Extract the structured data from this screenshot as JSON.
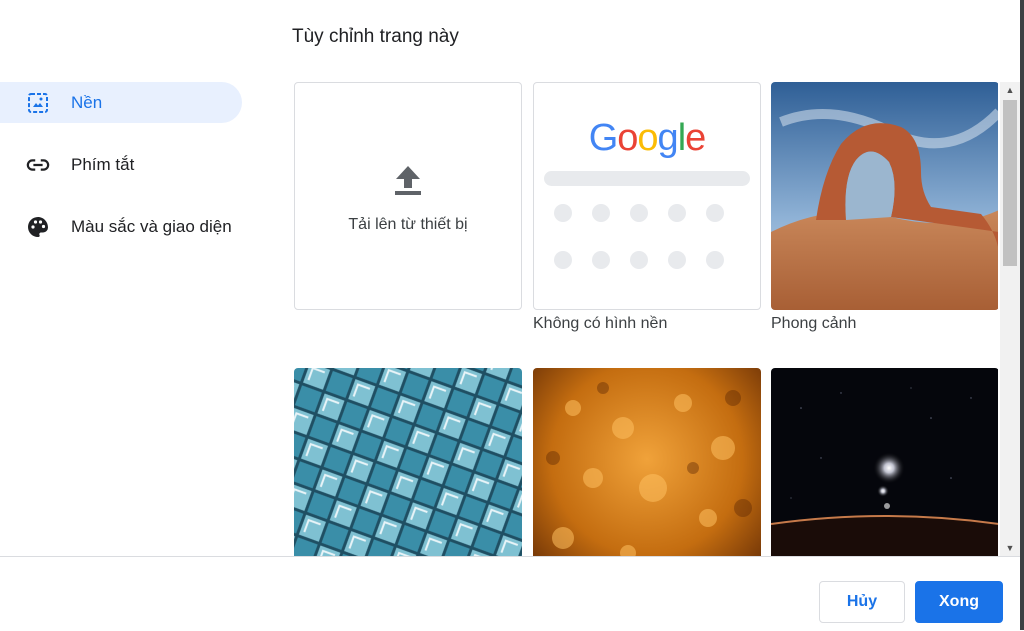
{
  "dialog": {
    "title": "Tùy chỉnh trang này"
  },
  "sidebar": {
    "items": [
      {
        "label": "Nền",
        "icon": "image-icon",
        "selected": true
      },
      {
        "label": "Phím tắt",
        "icon": "link-icon",
        "selected": false
      },
      {
        "label": "Màu sắc và giao diện",
        "icon": "palette-icon",
        "selected": false
      }
    ]
  },
  "backgrounds": {
    "upload_label": "Tải lên từ thiết bị",
    "no_background_label": "Không có hình nền",
    "google_logo": [
      "G",
      "o",
      "o",
      "g",
      "l",
      "e"
    ],
    "landscape_label": "Phong cảnh"
  },
  "footer": {
    "cancel_label": "Hủy",
    "done_label": "Xong"
  },
  "colors": {
    "accent": "#1a73e8",
    "selected_bg": "#e8f0fe"
  }
}
